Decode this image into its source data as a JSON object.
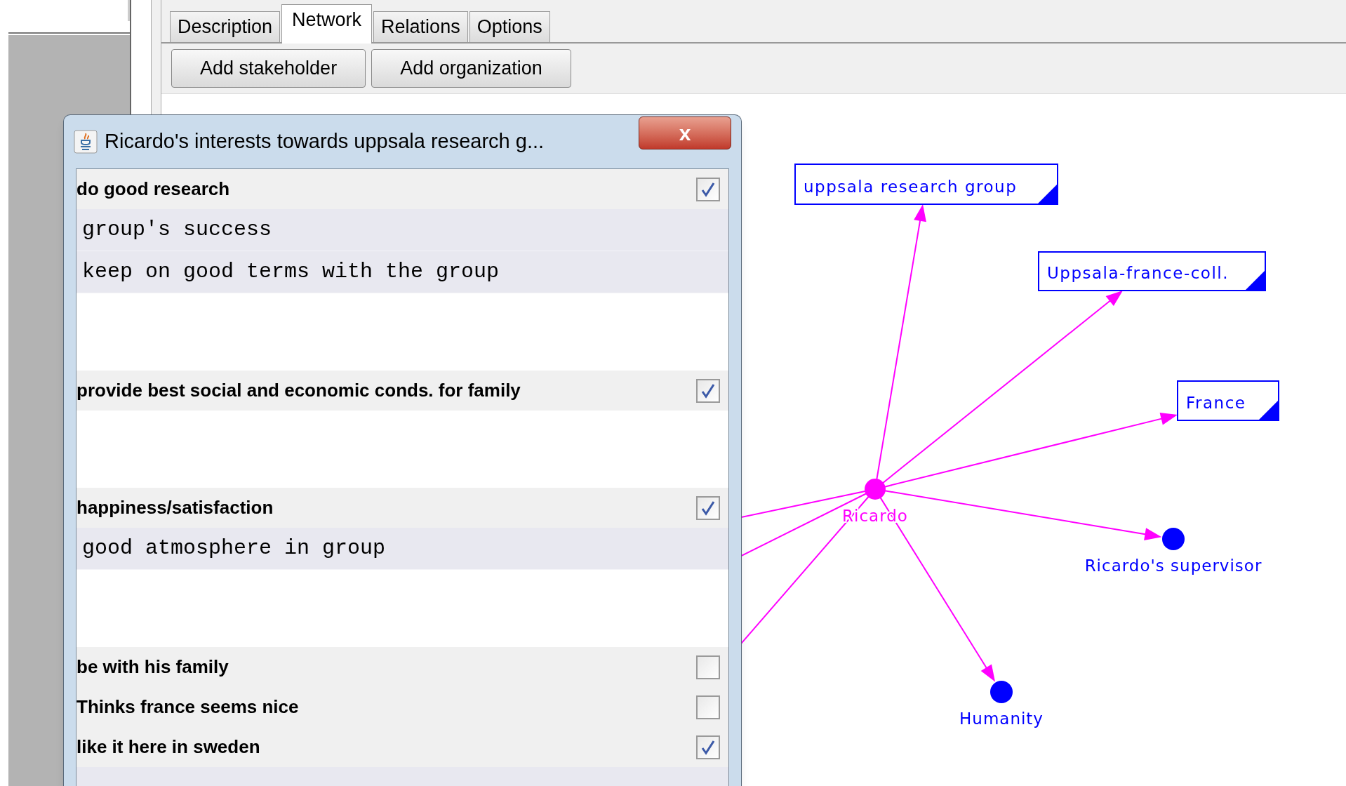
{
  "tabs": [
    {
      "label": "Description",
      "selected": false
    },
    {
      "label": "Network",
      "selected": true
    },
    {
      "label": "Relations",
      "selected": false
    },
    {
      "label": "Options",
      "selected": false
    }
  ],
  "toolbar": [
    "Add stakeholder",
    "Add organization"
  ],
  "network": {
    "nodes": [
      {
        "kind": "self",
        "label": "Ricardo"
      },
      {
        "kind": "organization",
        "label": "uppsala research group"
      },
      {
        "kind": "organization",
        "label": "Uppsala-france-coll."
      },
      {
        "kind": "organization",
        "label": "France"
      },
      {
        "kind": "stakeholder",
        "label": "Ricardo's supervisor"
      },
      {
        "kind": "stakeholder",
        "label": "Humanity"
      }
    ]
  },
  "dialog": {
    "title": "Ricardo's interests towards uppsala research g...",
    "close": "x",
    "rows": [
      {
        "kind": "goal",
        "text": "do good research",
        "checked": true
      },
      {
        "kind": "detail",
        "text": "group's success"
      },
      {
        "kind": "detail",
        "text": "keep on good terms with the group"
      },
      {
        "kind": "spacer"
      },
      {
        "kind": "goal",
        "text": "provide best social and economic conds. for family",
        "checked": true
      },
      {
        "kind": "spacer"
      },
      {
        "kind": "goal",
        "text": "happiness/satisfaction",
        "checked": true
      },
      {
        "kind": "detail",
        "text": "good atmosphere in group"
      },
      {
        "kind": "spacer"
      },
      {
        "kind": "goal",
        "text": "be with his family",
        "checked": false
      },
      {
        "kind": "goal",
        "text": "Thinks france seems nice",
        "checked": false
      },
      {
        "kind": "goal",
        "text": "like it here in sweden",
        "checked": true
      }
    ]
  }
}
